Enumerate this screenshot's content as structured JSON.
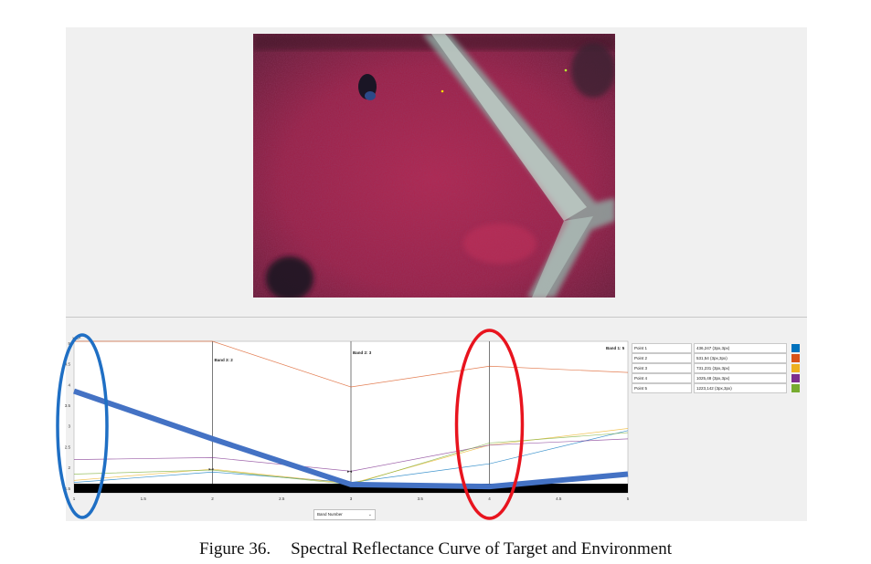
{
  "figure": {
    "number": "Figure 36.",
    "title": "Spectral Reflectance Curve of Target and Environment"
  },
  "image_view": {
    "content": "false-color aerial image"
  },
  "chart_data": {
    "type": "line",
    "scale_label": "×10⁵",
    "x_ticks": [
      "1",
      "1.5",
      "2",
      "2.5",
      "3",
      "3.5",
      "4",
      "4.5",
      "5"
    ],
    "y_ticks": [
      "1.5",
      "2",
      "2.5",
      "3",
      "3.5",
      "4",
      "4.5",
      "5"
    ],
    "xlim": [
      1,
      5
    ],
    "ylim": [
      1.4,
      5.05
    ],
    "band_labels": [
      {
        "text": "Band 3: 2",
        "x": 2
      },
      {
        "text": "Band 2: 3",
        "x": 3
      },
      {
        "text": "Band 1: 5",
        "x": 5
      }
    ],
    "x": [
      1,
      2,
      3,
      4,
      5
    ],
    "series": [
      {
        "name": "Point 1",
        "color": "#0072bd",
        "values": [
          1.65,
          1.9,
          1.65,
          2.1,
          2.9
        ]
      },
      {
        "name": "Point 2",
        "color": "#d95319",
        "values": [
          5.05,
          5.05,
          3.95,
          4.45,
          4.3
        ]
      },
      {
        "name": "Point 3",
        "color": "#edb120",
        "values": [
          1.7,
          1.97,
          1.62,
          2.55,
          2.95
        ]
      },
      {
        "name": "Point 4",
        "color": "#7e2f8e",
        "values": [
          2.2,
          2.25,
          1.92,
          2.55,
          2.7
        ]
      },
      {
        "name": "Point 5",
        "color": "#77ac30",
        "values": [
          1.85,
          1.95,
          1.6,
          2.6,
          2.85
        ]
      }
    ],
    "annotation_line": {
      "color": "#4472c4",
      "values": [
        3.85,
        2.7,
        1.6,
        1.55,
        1.85
      ]
    },
    "annotation_ellipses": [
      {
        "color": "#1f6fc4",
        "around_x": 1
      },
      {
        "color": "#e8141e",
        "around_x": 4
      }
    ],
    "x_axis_select": "Band Number"
  },
  "legend": [
    {
      "label": "Point 1",
      "value": "436,247 (3px,3px)",
      "color": "#0072bd"
    },
    {
      "label": "Point 2",
      "value": "531,54 (3px,3px)",
      "color": "#d95319"
    },
    {
      "label": "Point 3",
      "value": "731,231 (3px,3px)",
      "color": "#edb120"
    },
    {
      "label": "Point 4",
      "value": "1025,48 (3px,3px)",
      "color": "#7e2f8e"
    },
    {
      "label": "Point 5",
      "value": "1223,142 (3px,3px)",
      "color": "#77ac30"
    }
  ]
}
